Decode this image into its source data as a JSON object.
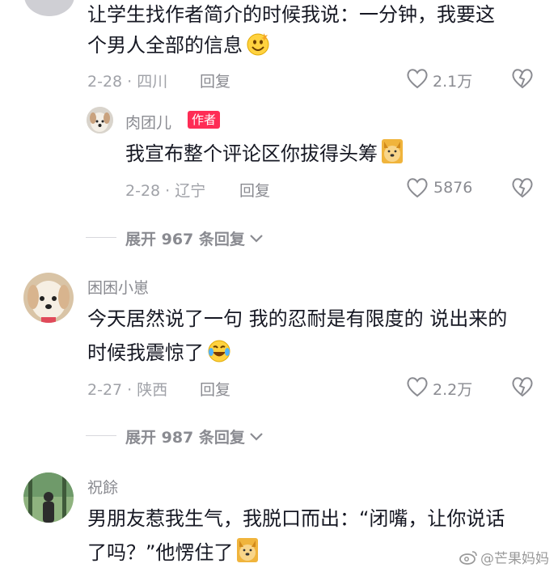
{
  "comments": [
    {
      "text_line1": "让学生找作者简介的时候我说：一分钟，我要这",
      "text_line2": "个男人全部的信息",
      "date_loc": "2-28 · 四川",
      "reply_label": "回复",
      "likes": "2.1万"
    },
    {
      "username": "肉团儿",
      "badge": "作者",
      "text": "我宣布整个评论区你拔得头筹",
      "date_loc": "2-28 · 辽宁",
      "reply_label": "回复",
      "likes": "5876",
      "expand_label": "展开 967 条回复"
    },
    {
      "username": "困困小崽",
      "text_line1": "今天居然说了一句 我的忍耐是有限度的 说出来的",
      "text_line2": "时候我震惊了",
      "date_loc": "2-27 · 陕西",
      "reply_label": "回复",
      "likes": "2.2万",
      "expand_label": "展开 987 条回复"
    },
    {
      "username": "祝餘",
      "text_line1": "男朋友惹我生气，我脱口而出：“闭嘴，让你说话",
      "text_line2": "了吗？”他愣住了"
    }
  ],
  "watermark": "@芒果妈妈",
  "icons": {
    "like": "heart-icon",
    "dislike": "broken-heart-icon",
    "expand": "chevron-down-icon"
  }
}
